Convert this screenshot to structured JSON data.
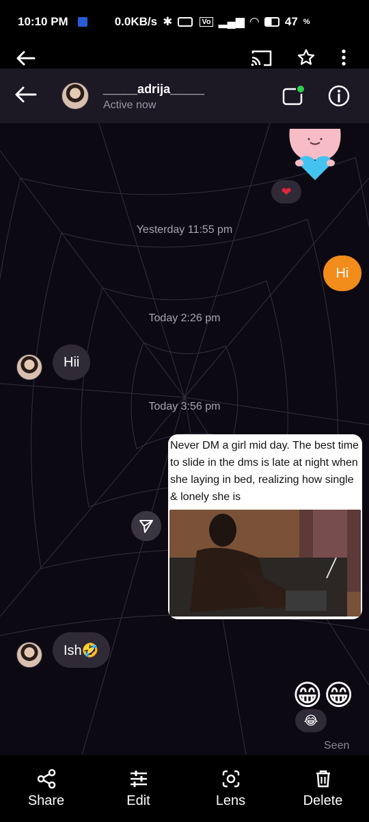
{
  "status_bar": {
    "time": "10:10 PM",
    "speed": "0.0KB/s",
    "battery": "47",
    "battery_unit": "%"
  },
  "chat": {
    "username": "_____adrija_____",
    "presence": "Active now",
    "messages": [
      {
        "type": "sticker",
        "from": "me",
        "reaction": "heart"
      },
      {
        "type": "timestamp",
        "text": "Yesterday 11:55 pm"
      },
      {
        "type": "text",
        "from": "me",
        "text": "Hi"
      },
      {
        "type": "timestamp",
        "text": "Today 2:26 pm"
      },
      {
        "type": "text",
        "from": "them",
        "text": "Hii"
      },
      {
        "type": "timestamp",
        "text": "Today 3:56 pm"
      },
      {
        "type": "meme",
        "from": "me",
        "caption": "Never DM a girl mid day. The best time to slide in the dms is late at night when she laying in bed, realizing how single & lonely she is"
      },
      {
        "type": "text",
        "from": "them",
        "text": "Ish🤣"
      },
      {
        "type": "emoji",
        "from": "me",
        "text": "😁😁",
        "reaction": "😂"
      }
    ],
    "seen": "Seen"
  },
  "actions": [
    {
      "label": "Share",
      "icon": "share-icon"
    },
    {
      "label": "Edit",
      "icon": "sliders-icon"
    },
    {
      "label": "Lens",
      "icon": "lens-icon"
    },
    {
      "label": "Delete",
      "icon": "trash-icon"
    }
  ],
  "colors": {
    "outgoing_bubble": "#f28c1a",
    "incoming_bubble": "#2f2a36",
    "chat_background": "#0d0913",
    "header_background": "#1c1824",
    "online_dot": "#2bd14a"
  }
}
